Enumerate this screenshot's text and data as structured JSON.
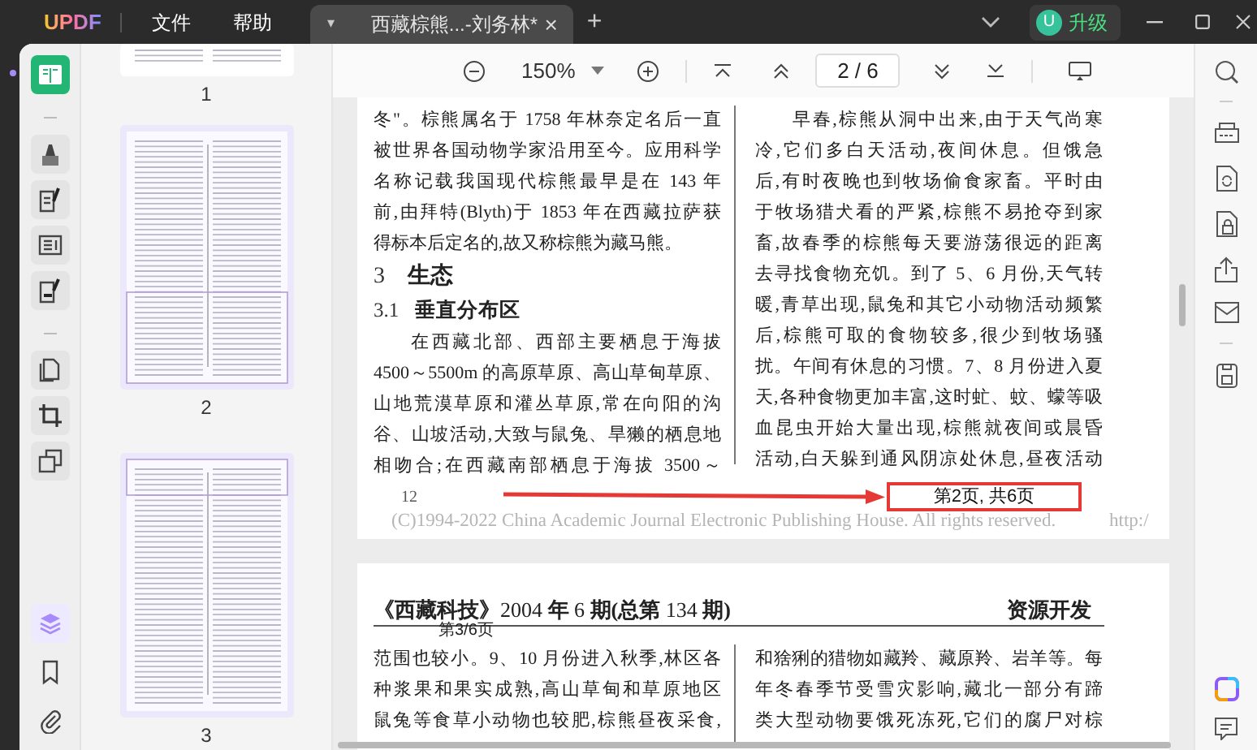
{
  "app": {
    "logo": "UPDF",
    "menus": [
      "文件",
      "帮助"
    ]
  },
  "tabs": [
    {
      "caret": "▾",
      "title": "西藏棕熊...-刘务林*",
      "close": "×",
      "selected": true
    }
  ],
  "new_tab": "+",
  "upgrade": {
    "avatar": "U",
    "label": "升级"
  },
  "toolbar": {
    "zoom": "150%",
    "page_field": "2 / 6"
  },
  "left_tools": [
    [
      {
        "kind": "reader",
        "selected": true
      }
    ],
    [
      {
        "kind": "comment",
        "selected": false
      },
      {
        "kind": "edit",
        "selected": false
      },
      {
        "kind": "form",
        "selected": false
      },
      {
        "kind": "sign",
        "selected": false
      }
    ],
    [
      {
        "kind": "organize",
        "selected": false
      },
      {
        "kind": "crop",
        "selected": false
      },
      {
        "kind": "compare",
        "selected": false
      }
    ]
  ],
  "panel_tools": [
    {
      "kind": "thumbnails",
      "selected": true
    },
    {
      "kind": "bookmarks",
      "selected": false
    },
    {
      "kind": "attachments",
      "selected": false
    }
  ],
  "thumbnails": [
    {
      "label": "1"
    },
    {
      "label": "2"
    },
    {
      "label": "3"
    }
  ],
  "pages": [
    {
      "columns": [
        [
          {
            "kind": "line",
            "text": "冬\"。棕熊属名于 1758 年林奈定名后一直"
          },
          {
            "kind": "line",
            "text": "被世界各国动物学家沿用至今。应用科学"
          },
          {
            "kind": "line",
            "text": "名称记载我国现代棕熊最早是在 143 年"
          },
          {
            "kind": "line",
            "text": "前,由拜特(Blyth)于 1853 年在西藏拉萨获"
          },
          {
            "kind": "last",
            "text": "得标本后定名的,故又称棕熊为藏马熊。"
          },
          {
            "kind": "heading",
            "number": "3",
            "text": "生态"
          },
          {
            "kind": "subheading",
            "number": "3.1",
            "text": "垂直分布区"
          },
          {
            "kind": "para_start",
            "text": "在西藏北部、西部主要栖息于海拔"
          },
          {
            "kind": "line",
            "text": "4500～5500m 的高原草原、高山草甸草原、"
          },
          {
            "kind": "line",
            "text": "山地荒漠草原和灌丛草原,常在向阳的沟"
          },
          {
            "kind": "line",
            "text": "谷、山坡活动,大致与鼠兔、旱獭的栖息地"
          },
          {
            "kind": "line",
            "text": "相吻合;在西藏南部栖息于海拔 3500～"
          }
        ],
        [
          {
            "kind": "para_start",
            "text": "早春,棕熊从洞中出来,由于天气尚寒"
          },
          {
            "kind": "line",
            "text": "冷,它们多白天活动,夜间休息。但饿急"
          },
          {
            "kind": "line",
            "text": "后,有时夜晚也到牧场偷食家畜。平时由"
          },
          {
            "kind": "line",
            "text": "于牧场猎犬看的严紧,棕熊不易抢夺到家"
          },
          {
            "kind": "line",
            "text": "畜,故春季的棕熊每天要游荡很远的距离"
          },
          {
            "kind": "line",
            "text": "去寻找食物充饥。到了 5、6 月份,天气转"
          },
          {
            "kind": "line",
            "text": "暖,青草出现,鼠兔和其它小动物活动频繁"
          },
          {
            "kind": "line",
            "text": "后,棕熊可取的食物较多,很少到牧场骚"
          },
          {
            "kind": "line",
            "text": "扰。午间有休息的习惯。7、8 月份进入夏"
          },
          {
            "kind": "line",
            "text": "天,各种食物更加丰富,这时虻、蚊、蠓等吸"
          },
          {
            "kind": "line",
            "text": "血昆虫开始大量出现,棕熊就夜间或晨昏"
          },
          {
            "kind": "line",
            "text": "活动,白天躲到通风阴凉处休息,昼夜活动"
          }
        ]
      ],
      "page_number": "12",
      "footer": "(C)1994-2022 China Academic Journal Electronic Publishing House. All rights reserved.",
      "footer_link": "http:/",
      "annotation": "第2页, 共6页"
    },
    {
      "header": "**《西藏科技》**2004 **年** 6 **期(总第** 134 **期)**",
      "section": "资源开发",
      "page_label": "第3/6页",
      "columns": [
        [
          {
            "kind": "line",
            "text": "范围也较小。9、10 月份进入秋季,林区各"
          },
          {
            "kind": "line",
            "text": "种浆果和果实成熟,高山草甸和草原地区"
          },
          {
            "kind": "line",
            "text": "鼠兔等食草小动物也较肥,棕熊昼夜采食,"
          }
        ],
        [
          {
            "kind": "line",
            "text": "和猞猁的猎物如藏羚、藏原羚、岩羊等。每"
          },
          {
            "kind": "line",
            "text": "年冬春季节受雪灾影响,藏北一部分有蹄"
          },
          {
            "kind": "line",
            "text": "类大型动物要饿死冻死,它们的腐尸对棕"
          }
        ]
      ]
    }
  ]
}
